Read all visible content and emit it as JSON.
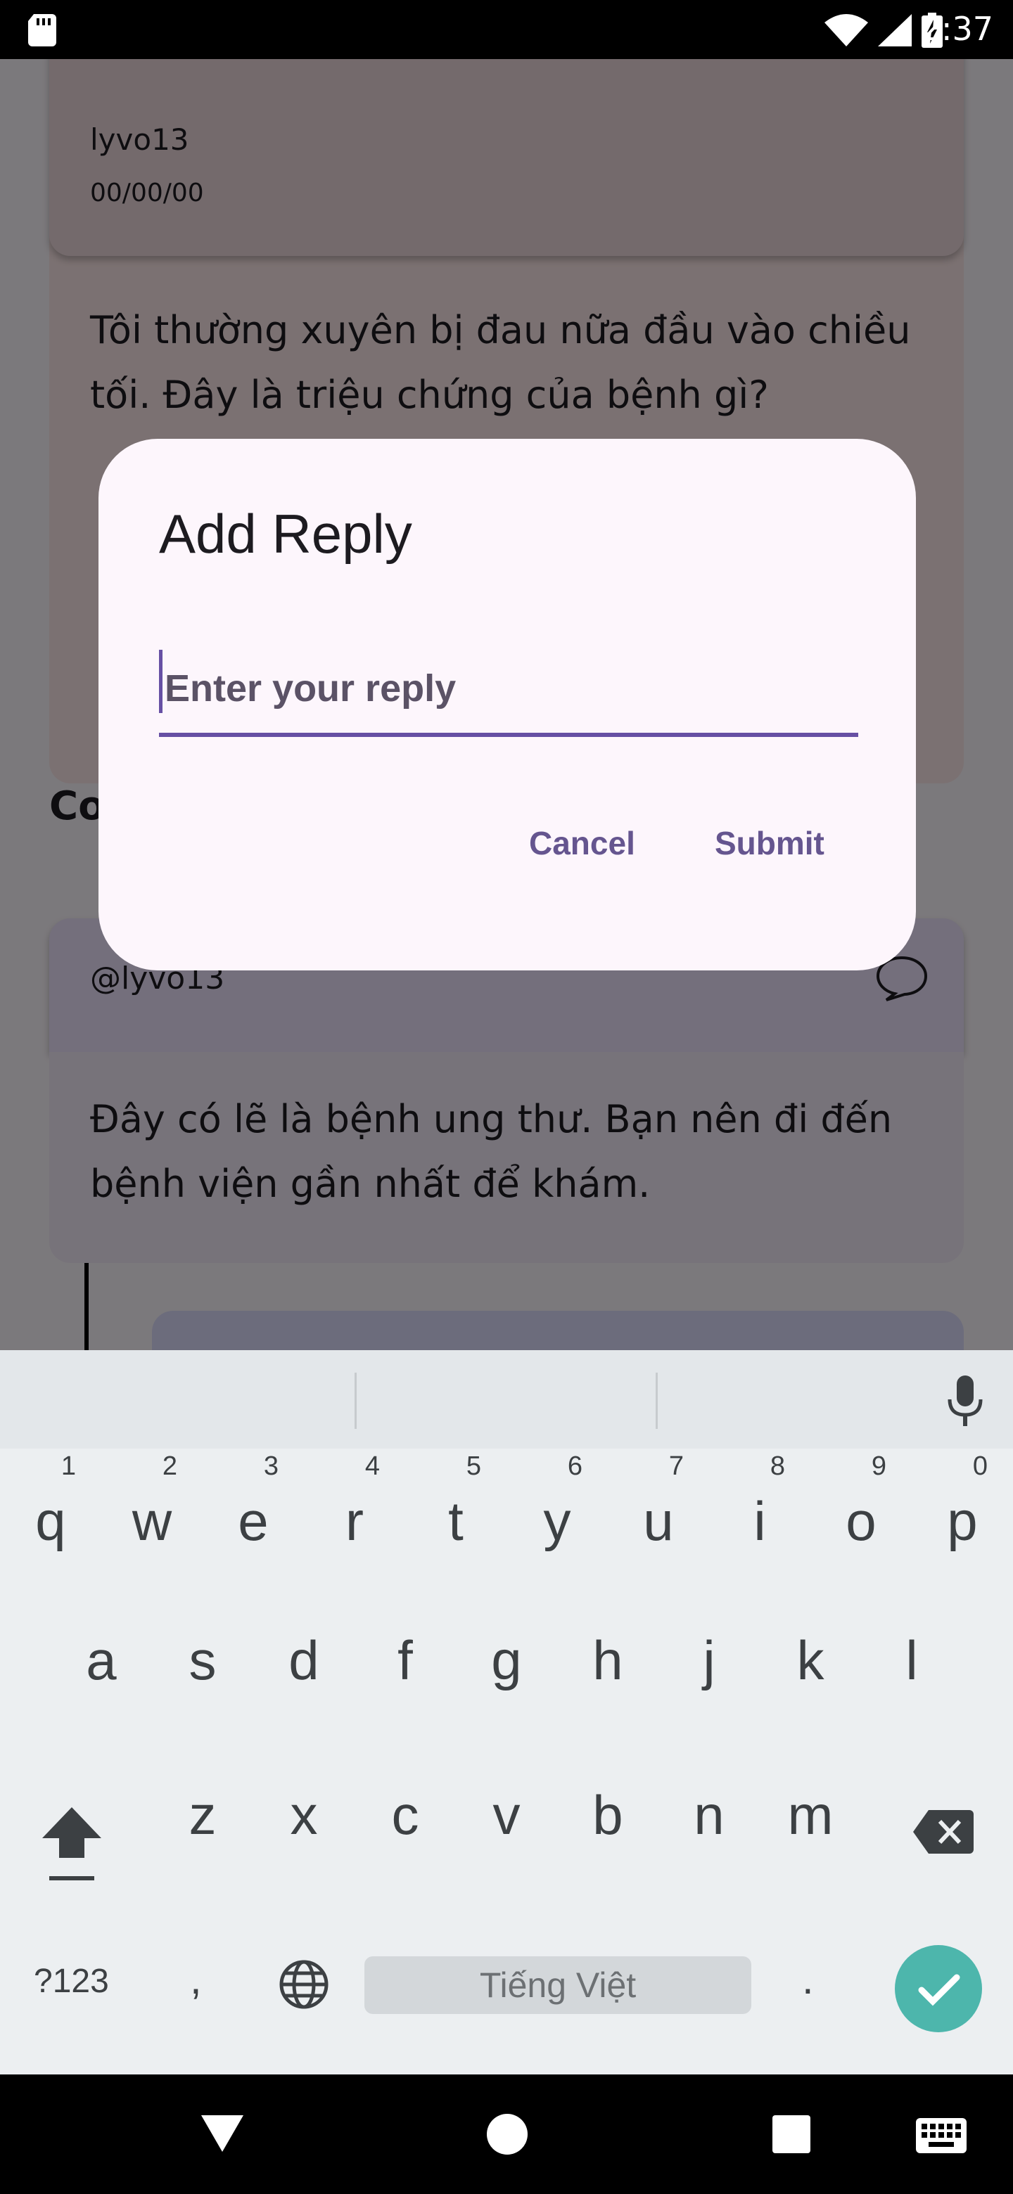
{
  "status_bar": {
    "time": "2:37"
  },
  "background_screen": {
    "post_author": "lyvo13",
    "post_date": "00/00/00",
    "post_body": "Tôi thường xuyên bị đau nữa đầu vào chiều tối. Đây là triệu chứng của bệnh gì?",
    "comments_title": "Co",
    "comment": {
      "author": "@lyvo13",
      "body": "Đây có lẽ là bệnh ung thư. Bạn nên đi đến bệnh viện gần nhất để khám."
    }
  },
  "dialog": {
    "title": "Add Reply",
    "input": {
      "placeholder": "Enter your reply",
      "value": ""
    },
    "cancel_label": "Cancel",
    "submit_label": "Submit"
  },
  "keyboard": {
    "row1": [
      {
        "key": "q",
        "hint": "1"
      },
      {
        "key": "w",
        "hint": "2"
      },
      {
        "key": "e",
        "hint": "3"
      },
      {
        "key": "r",
        "hint": "4"
      },
      {
        "key": "t",
        "hint": "5"
      },
      {
        "key": "y",
        "hint": "6"
      },
      {
        "key": "u",
        "hint": "7"
      },
      {
        "key": "i",
        "hint": "8"
      },
      {
        "key": "o",
        "hint": "9"
      },
      {
        "key": "p",
        "hint": "0"
      }
    ],
    "row2": [
      "a",
      "s",
      "d",
      "f",
      "g",
      "h",
      "j",
      "k",
      "l"
    ],
    "row3": [
      "z",
      "x",
      "c",
      "v",
      "b",
      "n",
      "m"
    ],
    "symbols_label": "?123",
    "comma_label": ",",
    "space_label": "Tiếng Việt",
    "period_label": ".",
    "accent_color": "#4db6ac"
  },
  "colors": {
    "primary": "#6750a4",
    "dialog_surface": "#fdf6fc"
  }
}
